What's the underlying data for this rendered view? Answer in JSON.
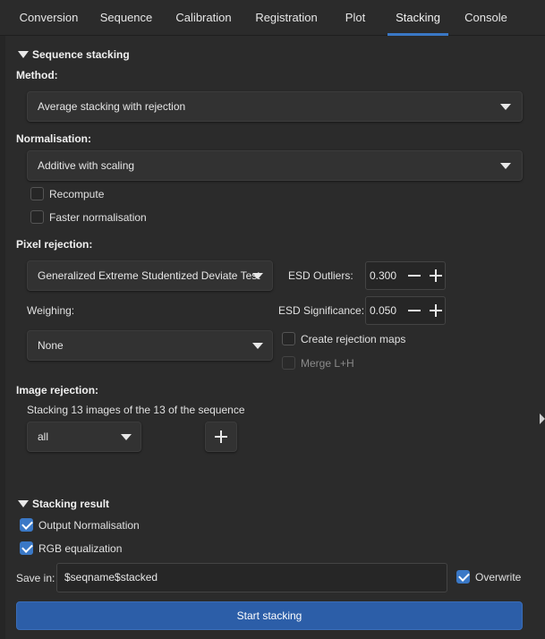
{
  "tabs": [
    {
      "label": "Conversion"
    },
    {
      "label": "Sequence"
    },
    {
      "label": "Calibration"
    },
    {
      "label": "Registration"
    },
    {
      "label": "Plot"
    },
    {
      "label": "Stacking",
      "active": true
    },
    {
      "label": "Console"
    }
  ],
  "stacking": {
    "section_title": "Sequence stacking",
    "method_label": "Method:",
    "method_value": "Average stacking with rejection",
    "normalisation_label": "Normalisation:",
    "normalisation_value": "Additive with scaling",
    "recompute_label": "Recompute",
    "faster_norm_label": "Faster normalisation",
    "pixel_rejection_label": "Pixel rejection:",
    "rejection_value": "Generalized Extreme Studentized Deviate Test",
    "esd_outliers_label": "ESD Outliers:",
    "esd_outliers_value": "0.300",
    "esd_significance_label": "ESD Significance:",
    "esd_significance_value": "0.050",
    "weighing_label": "Weighing:",
    "weighing_value": "None",
    "create_maps_label": "Create rejection maps",
    "merge_label": "Merge L+H",
    "image_rejection_label": "Image rejection:",
    "stacking_info": "Stacking 13 images of the 13 of the sequence",
    "image_filter_value": "all"
  },
  "result": {
    "section_title": "Stacking result",
    "output_norm_label": "Output Normalisation",
    "output_norm_checked": true,
    "rgb_eq_label": "RGB equalization",
    "rgb_eq_checked": true,
    "save_in_label": "Save in:",
    "save_in_value": "$seqname$stacked",
    "overwrite_label": "Overwrite",
    "overwrite_checked": true,
    "start_button": "Start stacking"
  },
  "colors": {
    "accent": "#3a78c6",
    "primary_button": "#2c5ea8",
    "background": "#2b2b2b"
  }
}
